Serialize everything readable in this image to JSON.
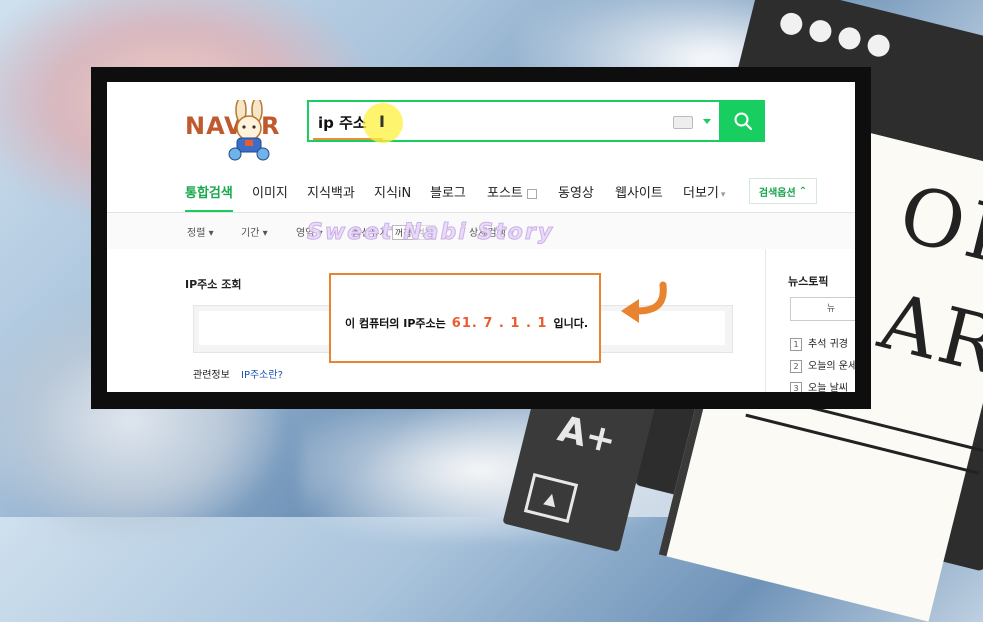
{
  "header": {
    "logo_text": "NAVER",
    "search_query": "ip 주소"
  },
  "tabs": [
    {
      "label": "통합검색",
      "active": true
    },
    {
      "label": "이미지"
    },
    {
      "label": "지식백과"
    },
    {
      "label": "지식iN"
    },
    {
      "label": "블로그"
    },
    {
      "label": "포스트"
    },
    {
      "label": "동영상"
    },
    {
      "label": "웹사이트"
    },
    {
      "label": "더보기"
    }
  ],
  "search_options_label": "검색옵션",
  "filters": {
    "sort": "정렬",
    "period": "기간",
    "area": "영역",
    "keep_option": "옵션유지",
    "keep_off": "꺼짐",
    "keep_on": "켜짐",
    "detail_search": "상세검색"
  },
  "watermark": "Sweet Nabi Story",
  "ip_lookup": {
    "title": "IP주소 조회",
    "message_prefix": "이 컴퓨터의 IP주소는",
    "ip_address": "61. 7 . 1 . 1",
    "message_suffix": "입니다.",
    "related_label": "관련정보",
    "related_link": "IP주소란?"
  },
  "news": {
    "title": "뉴스토픽",
    "button_label": "뉴",
    "items": [
      {
        "num": "1",
        "text": "추석 귀경"
      },
      {
        "num": "2",
        "text": "오늘의 운세"
      },
      {
        "num": "3",
        "text": "오늘 날씨"
      }
    ]
  },
  "colors": {
    "naver_green": "#19ce60",
    "highlight_orange": "#e8842f",
    "ip_red": "#e85d2f"
  }
}
